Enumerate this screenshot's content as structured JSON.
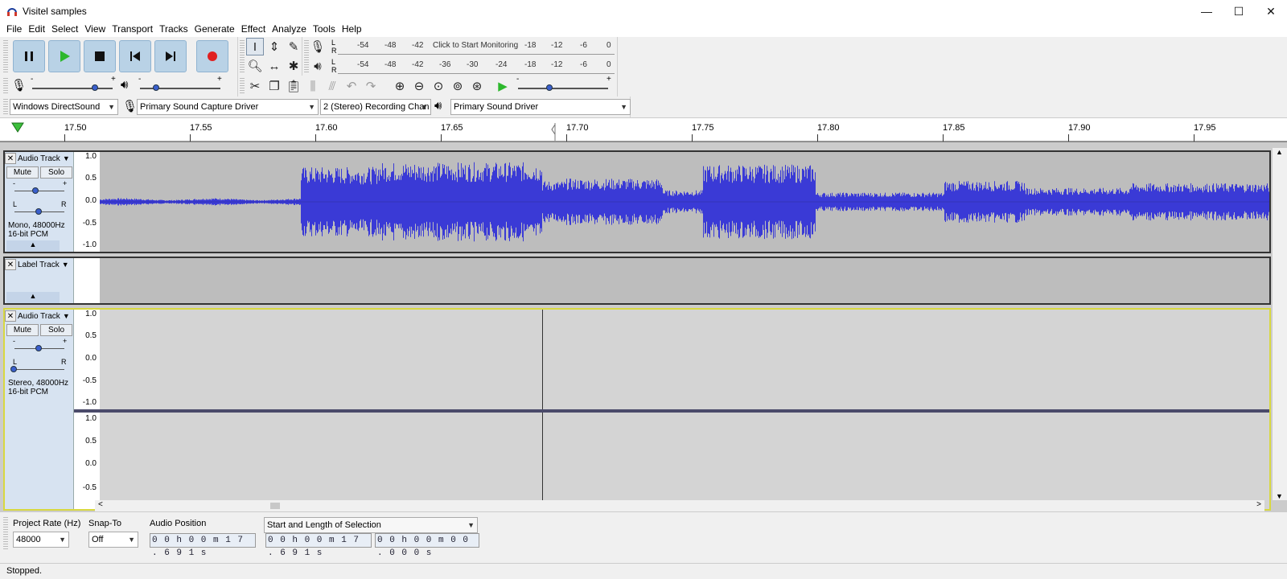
{
  "window": {
    "title": "Visitel samples",
    "minimize": "—",
    "maximize": "☐",
    "close": "✕"
  },
  "menu": [
    "File",
    "Edit",
    "Select",
    "View",
    "Transport",
    "Tracks",
    "Generate",
    "Effect",
    "Analyze",
    "Tools",
    "Help"
  ],
  "meters": {
    "record_scale": [
      "-54",
      "-48",
      "-42",
      "-18",
      "-12",
      "-6",
      "0"
    ],
    "record_prompt": "Click to Start Monitoring",
    "play_scale": [
      "-54",
      "-48",
      "-42",
      "-36",
      "-30",
      "-24",
      "-18",
      "-12",
      "-6",
      "0"
    ],
    "L": "L",
    "R": "R"
  },
  "sliders": {
    "minus": "-",
    "plus": "+",
    "record_volume": 0.78,
    "playback_volume": 0.2,
    "play_at_speed": 0.35
  },
  "devices": {
    "host": "Windows DirectSound",
    "recording_device": "Primary Sound Capture Driver",
    "recording_channels": "2 (Stereo) Recording Chan",
    "playback_device": "Primary Sound Driver"
  },
  "timeline": {
    "ticks": [
      "17.50",
      "17.55",
      "17.60",
      "17.65",
      "17.70",
      "17.75",
      "17.80",
      "17.85",
      "17.90",
      "17.95"
    ]
  },
  "tracks": [
    {
      "name": "Audio Track",
      "mute": "Mute",
      "solo": "Solo",
      "info1": "Mono, 48000Hz",
      "info2": "16-bit PCM",
      "ruler": [
        "1.0",
        "0.5",
        "0.0",
        "-0.5",
        "-1.0"
      ],
      "gain_minus": "-",
      "gain_plus": "+",
      "pan_left": "L",
      "pan_right": "R"
    },
    {
      "name": "Label Track"
    },
    {
      "name": "Audio Track",
      "mute": "Mute",
      "solo": "Solo",
      "info1": "Stereo, 48000Hz",
      "info2": "16-bit PCM",
      "ruler_top": [
        "1.0",
        "0.5",
        "0.0",
        "-0.5",
        "-1.0"
      ],
      "ruler_bottom": [
        "1.0",
        "0.5",
        "0.0",
        "-0.5"
      ],
      "gain_minus": "-",
      "gain_plus": "+",
      "pan_left": "L",
      "pan_right": "R"
    }
  ],
  "selection_bar": {
    "project_rate_label": "Project Rate (Hz)",
    "project_rate": "48000",
    "snap_label": "Snap-To",
    "snap_value": "Off",
    "audio_position_label": "Audio Position",
    "audio_position": "0 0 h 0 0 m 1 7 . 6 9 1 s",
    "selection_mode": "Start and Length of Selection",
    "selection_start": "0 0 h 0 0 m 1 7 . 6 9 1 s",
    "selection_length": "0 0 h 0 0 m 0 0 . 0 0 0 s"
  },
  "status": "Stopped.",
  "colors": {
    "accent": "#3a3ad6",
    "wave": "#3a3ad6",
    "record": "#e02020",
    "play": "#2db82d"
  }
}
